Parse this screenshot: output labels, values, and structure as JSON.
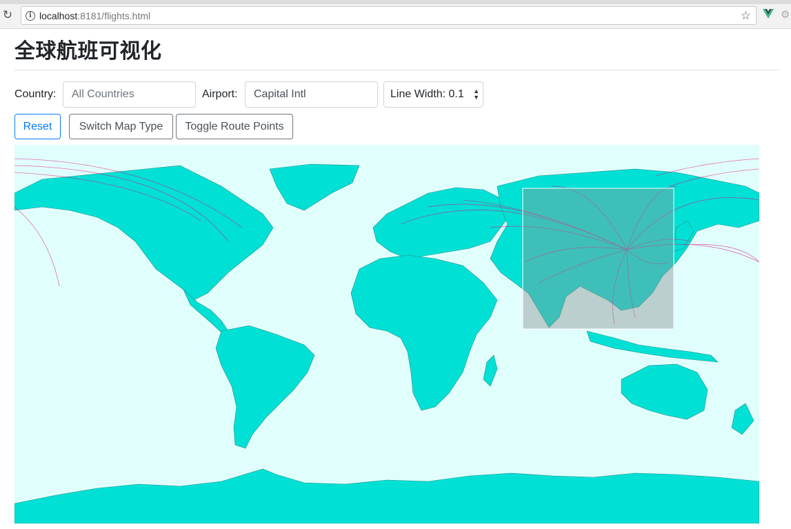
{
  "browser": {
    "url_host": "localhost",
    "url_rest": ":8181/flights.html"
  },
  "page": {
    "title": "全球航班可视化"
  },
  "controls": {
    "country_label": "Country:",
    "country_placeholder": "All Countries",
    "airport_label": "Airport:",
    "airport_value": "Capital Intl",
    "line_width_value": "Line Width: 0.1",
    "reset_label": "Reset",
    "switch_map_label": "Switch Map Type",
    "toggle_points_label": "Toggle Route Points"
  },
  "map": {
    "hub_airport": "Capital Intl",
    "land_color": "#00e0d5",
    "ocean_color": "#e0fefc",
    "route_color": "#e0107a"
  }
}
